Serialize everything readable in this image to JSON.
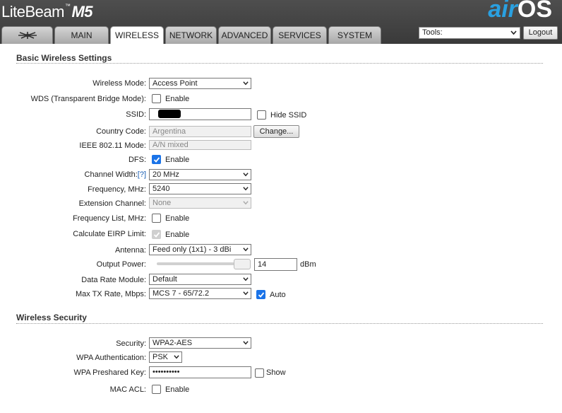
{
  "header": {
    "brand_name": "LiteBeam",
    "brand_tm": "™",
    "brand_model": "M5",
    "logo_air": "air",
    "logo_os": "OS"
  },
  "tabs": [
    {
      "label": "",
      "icon": "ubiquiti-logo-icon"
    },
    {
      "label": "MAIN"
    },
    {
      "label": "WIRELESS",
      "active": true
    },
    {
      "label": "NETWORK"
    },
    {
      "label": "ADVANCED"
    },
    {
      "label": "SERVICES"
    },
    {
      "label": "SYSTEM"
    }
  ],
  "toolbar": {
    "tools_value": "Tools:",
    "logout_label": "Logout"
  },
  "basic": {
    "title": "Basic Wireless Settings",
    "wireless_mode_label": "Wireless Mode:",
    "wireless_mode_value": "Access Point",
    "wds_label": "WDS (Transparent Bridge Mode):",
    "wds_enable": "Enable",
    "ssid_label": "SSID:",
    "hide_ssid": "Hide SSID",
    "country_label": "Country Code:",
    "country_value": "Argentina",
    "change_btn": "Change...",
    "ieee_label": "IEEE 802.11 Mode:",
    "ieee_value": "A/N mixed",
    "dfs_label": "DFS:",
    "dfs_enable": "Enable",
    "channel_width_label": "Channel Width:",
    "channel_width_help": "[?]",
    "channel_width_value": "20 MHz",
    "frequency_label": "Frequency, MHz:",
    "frequency_value": "5240",
    "ext_channel_label": "Extension Channel:",
    "ext_channel_value": "None",
    "freq_list_label": "Frequency List, MHz:",
    "freq_list_enable": "Enable",
    "eirp_label": "Calculate EIRP Limit:",
    "eirp_enable": "Enable",
    "antenna_label": "Antenna:",
    "antenna_value": "Feed only (1x1) - 3 dBi",
    "output_power_label": "Output Power:",
    "output_power_value": "14",
    "output_power_unit": "dBm",
    "data_rate_label": "Data Rate Module:",
    "data_rate_value": "Default",
    "max_tx_label": "Max TX Rate, Mbps:",
    "max_tx_value": "MCS 7 - 65/72.2",
    "max_tx_auto": "Auto"
  },
  "security": {
    "title": "Wireless Security",
    "security_label": "Security:",
    "security_value": "WPA2-AES",
    "wpa_auth_label": "WPA Authentication:",
    "wpa_auth_value": "PSK",
    "wpa_key_label": "WPA Preshared Key:",
    "wpa_key_value": "••••••••••",
    "wpa_key_show": "Show",
    "mac_acl_label": "MAC ACL:",
    "mac_acl_enable": "Enable"
  }
}
